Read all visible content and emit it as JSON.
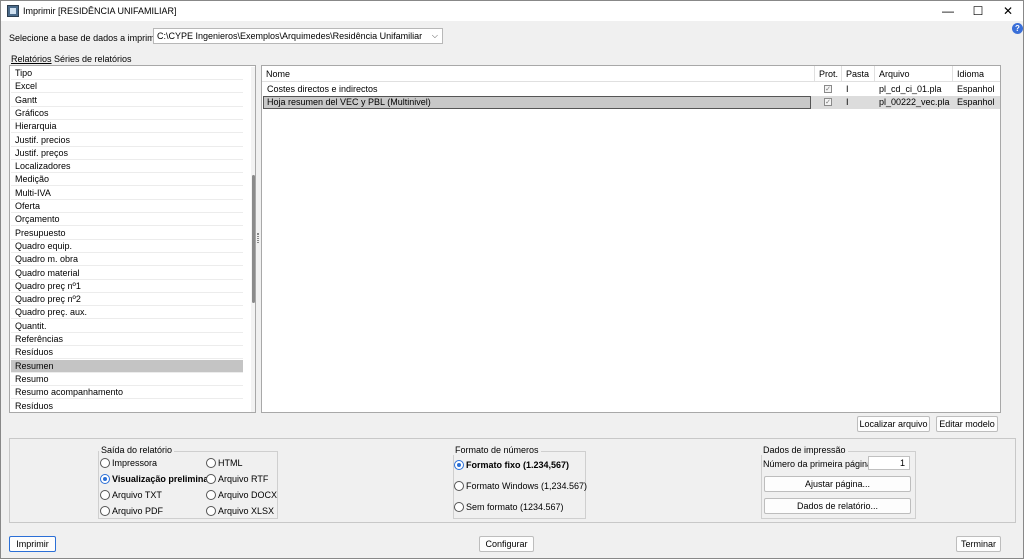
{
  "window": {
    "title": "Imprimir [RESIDÊNCIA UNIFAMILIAR]",
    "controls": {
      "minimize": "—",
      "maximize": "☐",
      "close": "✕"
    },
    "help": "?"
  },
  "database": {
    "label": "Selecione a base de dados a imprimir",
    "value": "C:\\CYPE Ingenieros\\Exemplos\\Arquimedes\\Residência Unifamiliar"
  },
  "tabs": [
    {
      "label": "Relatórios",
      "active": true
    },
    {
      "label": "Séries de relatórios",
      "active": false
    }
  ],
  "types": {
    "selected_index": 22,
    "items": [
      "Tipo",
      "Excel",
      "Gantt",
      "Gráficos",
      "Hierarquia",
      "Justif. precios",
      "Justif. preços",
      "Localizadores",
      "Medição",
      "Multi-IVA",
      "Oferta",
      "Orçamento",
      "Presupuesto",
      "Quadro equip.",
      "Quadro m. obra",
      "Quadro material",
      "Quadro preç nº1",
      "Quadro preç nº2",
      "Quadro preç. aux.",
      "Quantit.",
      "Referências",
      "Resíduos",
      "Resumen",
      "Resumo",
      "Resumo acompanhamento",
      "Resíduos"
    ]
  },
  "reports": {
    "columns": [
      "Nome",
      "Prot.",
      "Pasta",
      "Arquivo",
      "Idioma"
    ],
    "rows": [
      {
        "name": "Costes directos e indirectos",
        "prot": true,
        "pasta": "I",
        "arquivo": "pl_cd_ci_01.pla",
        "idioma": "Espanhol"
      },
      {
        "name": "Hoja resumen del VEC y PBL (Multinivel)",
        "prot": true,
        "pasta": "I",
        "arquivo": "pl_00222_vec.pla",
        "idioma": "Espanhol"
      }
    ],
    "selected_row": 1
  },
  "actions": {
    "locate": "Localizar arquivo",
    "edit": "Editar modelo"
  },
  "output": {
    "title": "Saída do relatório",
    "options": [
      "Impressora",
      "Visualização preliminar",
      "Arquivo TXT",
      "Arquivo PDF",
      "HTML",
      "Arquivo RTF",
      "Arquivo DOCX",
      "Arquivo XLSX"
    ],
    "selected": "Visualização preliminar"
  },
  "number_format": {
    "title": "Formato de números",
    "options": [
      "Formato fixo (1.234,567)",
      "Formato Windows (1,234.567)",
      "Sem formato (1234.567)"
    ],
    "selected": "Formato fixo (1.234,567)"
  },
  "print_data": {
    "title": "Dados de impressão",
    "first_page_label": "Número da primeira página",
    "first_page_value": "1",
    "adjust_button": "Ajustar página...",
    "report_data_button": "Dados de relatório..."
  },
  "footer": {
    "print": "Imprimir",
    "configure": "Configurar",
    "finish": "Terminar"
  },
  "colors": {
    "accent": "#2b6fd6",
    "selection": "#c4c4c4",
    "window_bg": "#f0f0f0"
  }
}
